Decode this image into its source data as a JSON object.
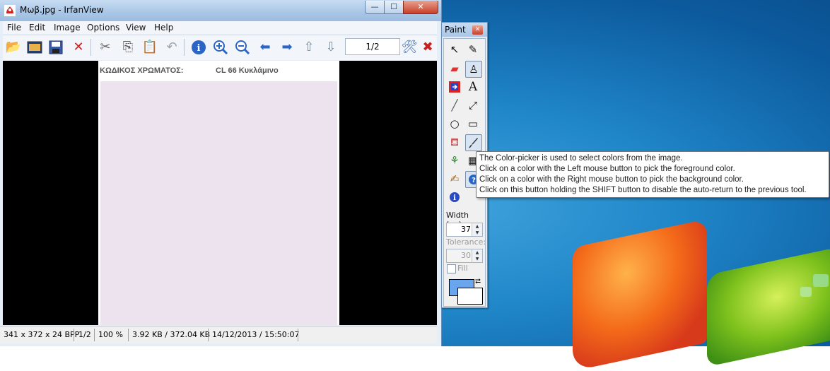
{
  "window": {
    "title": "Μωβ.jpg - IrfanView",
    "buttons": {
      "minimize": "—",
      "maximize": "☐",
      "close": "✕"
    }
  },
  "menu": [
    "File",
    "Edit",
    "Image",
    "Options",
    "View",
    "Help"
  ],
  "toolbar": {
    "page_indicator": "1/2",
    "icons": [
      "open-folder-icon",
      "slideshow-icon",
      "save-icon",
      "delete-icon",
      "cut-icon",
      "copy-icon",
      "paste-icon",
      "undo-icon",
      "info-icon",
      "zoom-in-icon",
      "zoom-out-icon",
      "previous-icon",
      "next-icon",
      "page-up-icon",
      "page-down-icon",
      "settings-icon",
      "exit-icon"
    ]
  },
  "document": {
    "label": "ΚΩΔΙΚΟΣ ΧΡΩΜΑΤΟΣ:",
    "value": "CL 66 Κυκλάμινο",
    "swatch_color": "#ede3ef"
  },
  "status": {
    "dimensions": "341 x 372 x 24 BPP",
    "page": "1/2",
    "zoom": "100 %",
    "size": "3.92 KB / 372.04 KB",
    "datetime": "14/12/2013 / 15:50:07"
  },
  "paint": {
    "title": "Paint",
    "close": "✕",
    "width_label": "Width (px)",
    "width_value": "37",
    "tolerance_label": "Tolerance:",
    "tolerance_value": "30",
    "fill_label": "Fill",
    "foreground_color": "#6aa6ee",
    "background_color": "#ffffff"
  },
  "tooltip": {
    "lines": [
      "The Color-picker is used to select colors from the image.",
      "Click on a color with the Left mouse button to pick the foreground color.",
      "Click on a color with the Right mouse button to pick the background color.",
      "Click on this button holding the SHIFT button to disable the auto-return to the previous tool."
    ]
  }
}
